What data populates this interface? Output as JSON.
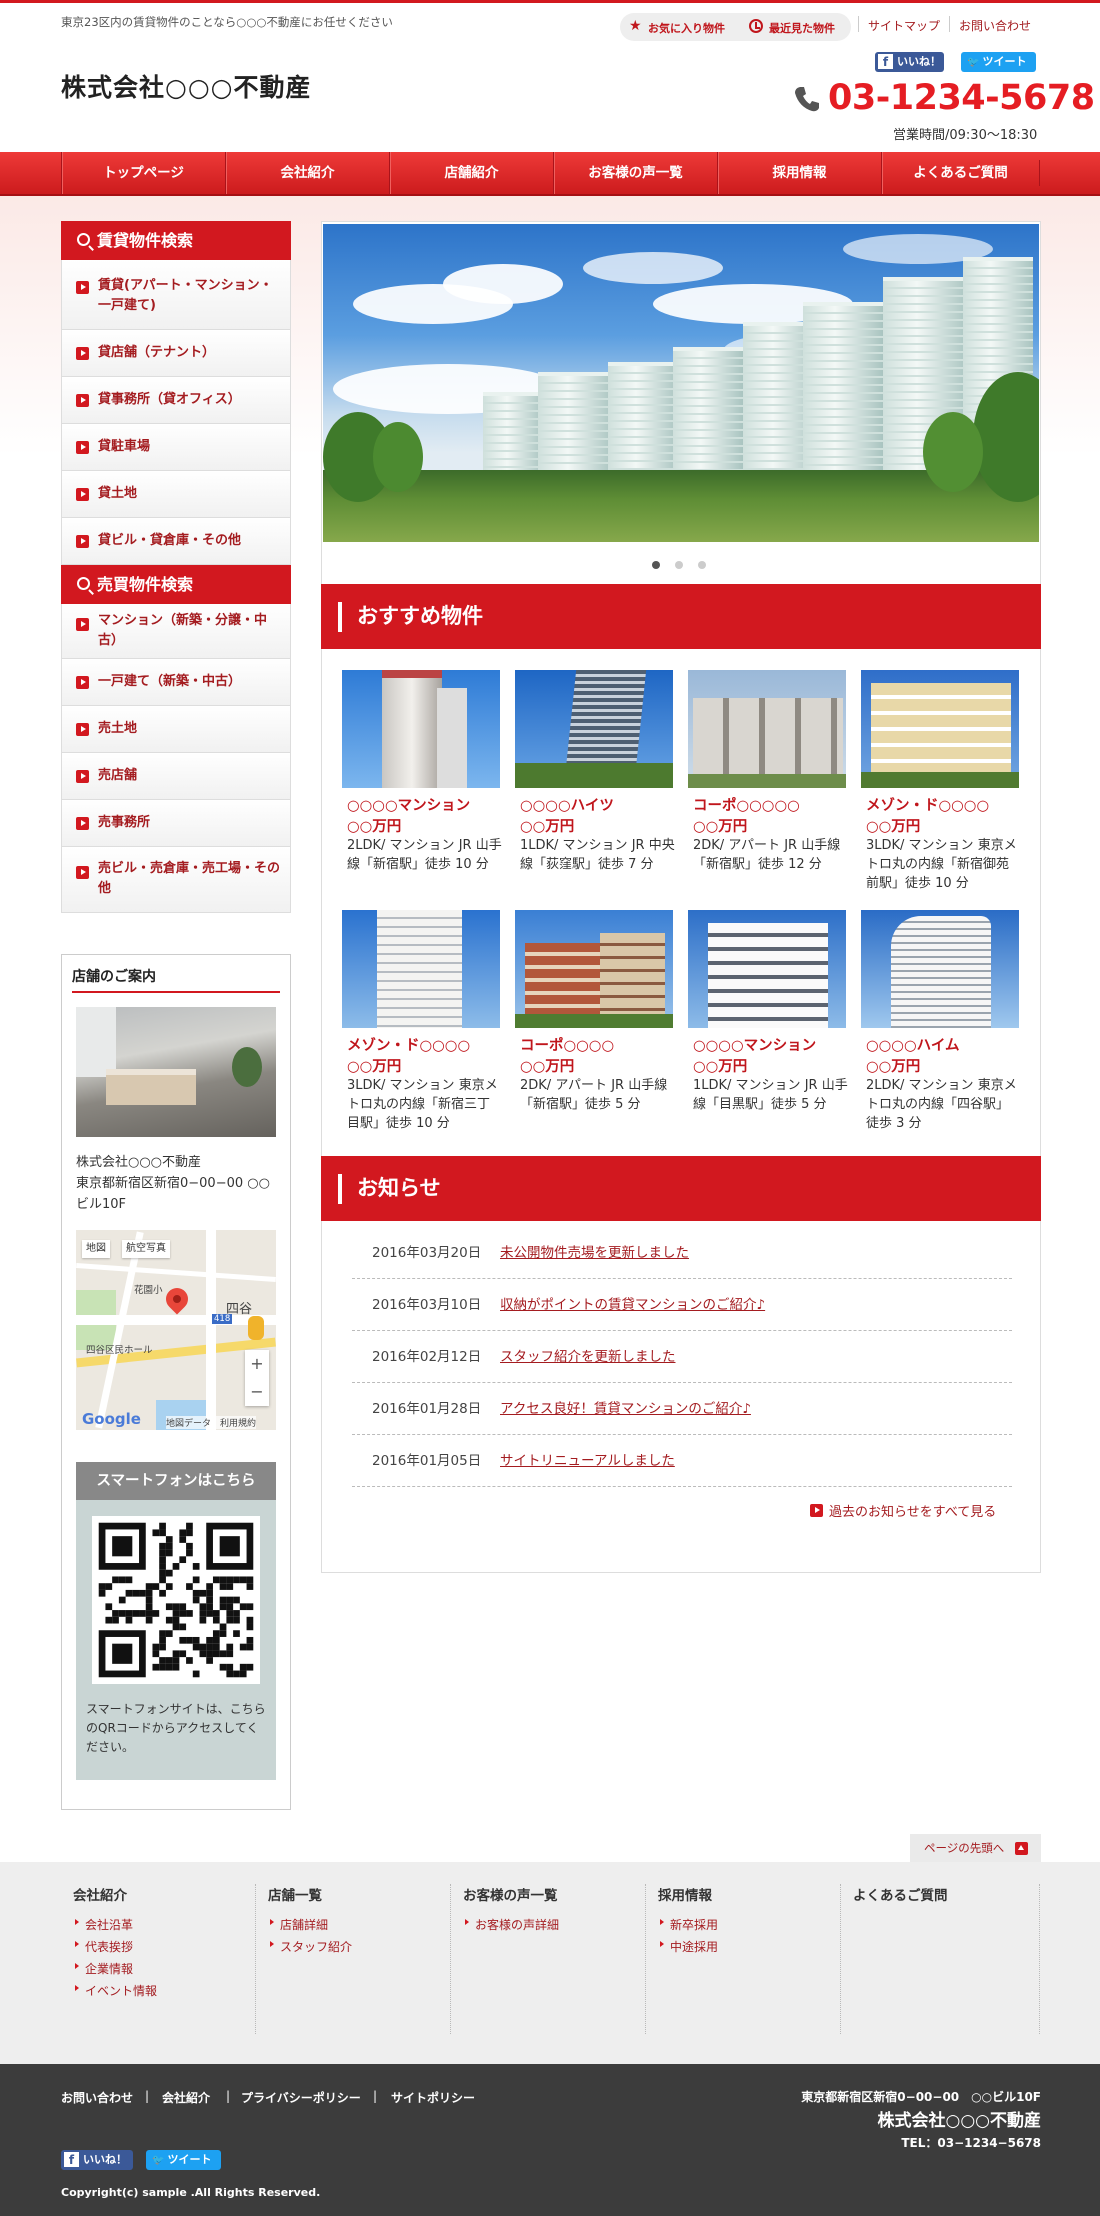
{
  "header": {
    "tagline": "東京23区内の賃貸物件のことなら○○○不動産にお任せください",
    "favorites": "お気に入り物件",
    "recently_viewed": "最近見た物件",
    "sitemap": "サイトマップ",
    "contact": "お問い合わせ",
    "company_name": "株式会社○○○不動産",
    "like": "いいね！",
    "tweet": "ツイート",
    "phone": "03-1234-5678",
    "hours": "営業時間/09:30〜18:30"
  },
  "nav": [
    "トップページ",
    "会社紹介",
    "店舗紹介",
    "お客様の声一覧",
    "採用情報",
    "よくあるご質問"
  ],
  "sidebar": {
    "rental_title": "賃貸物件検索",
    "rental_items": [
      "賃貸(アパート・マンション・一戸建て)",
      "貸店舗（テナント）",
      "貸事務所（貸オフィス）",
      "貸駐車場",
      "貸土地",
      "貸ビル・貸倉庫・その他"
    ],
    "sale_title": "売買物件検索",
    "sale_items": [
      "マンション（新築・分譲・中古）",
      "一戸建て（新築・中古）",
      "売土地",
      "売店舗",
      "売事務所",
      "売ビル・売倉庫・売工場・その他"
    ],
    "shop_title": "店舗のご案内",
    "shop_name": "株式会社○○○不動産",
    "shop_address": "東京都新宿区新宿0−00−00 ○○ビル10F",
    "map": {
      "tab_map": "地図",
      "tab_sat": "航空写真",
      "label_hanazono": "花園小",
      "label_yotsuya": "四谷",
      "label_road": "四谷区民ホール",
      "label_route": "418",
      "credit": "地図データ　利用規約",
      "zoom_in": "+",
      "zoom_out": "−"
    },
    "smartphone_title": "スマートフォンはこちら",
    "smartphone_text": "スマートフォンサイトは、こちらのQRコードからアクセスしてください。"
  },
  "slider": {
    "slide_count": 3,
    "active_index": 0
  },
  "recommend": {
    "title": "おすすめ物件",
    "items": [
      {
        "name": "○○○○マンション",
        "price": "○○万円",
        "detail": "2LDK/ マンション JR 山手線「新宿駅」徒歩 10 分"
      },
      {
        "name": "○○○○ハイツ",
        "price": "○○万円",
        "detail": "1LDK/ マンション JR 中央線「荻窪駅」徒歩 7 分"
      },
      {
        "name": "コーポ○○○○○",
        "price": "○○万円",
        "detail": "2DK/ アパート JR 山手線「新宿駅」徒歩 12 分"
      },
      {
        "name": "メゾン・ド○○○○",
        "price": "○○万円",
        "detail": "3LDK/ マンション 東京メトロ丸の内線「新宿御苑前駅」徒歩 10 分"
      },
      {
        "name": "メゾン・ド○○○○",
        "price": "○○万円",
        "detail": "3LDK/ マンション 東京メトロ丸の内線「新宿三丁目駅」徒歩 10 分"
      },
      {
        "name": "コーポ○○○○",
        "price": "○○万円",
        "detail": "2DK/ アパート JR 山手線「新宿駅」徒歩 5 分"
      },
      {
        "name": "○○○○マンション",
        "price": "○○万円",
        "detail": "1LDK/ マンション JR 山手線「目黒駅」徒歩 5 分"
      },
      {
        "name": "○○○○ハイム",
        "price": "○○万円",
        "detail": "2LDK/ マンション 東京メトロ丸の内線「四谷駅」徒歩 3 分"
      }
    ]
  },
  "news": {
    "title": "お知らせ",
    "items": [
      {
        "date": "2016年03月20日",
        "text": "未公開物件売場を更新しました"
      },
      {
        "date": "2016年03月10日",
        "text": "収納がポイントの賃貸マンションのご紹介♪"
      },
      {
        "date": "2016年02月12日",
        "text": "スタッフ紹介を更新しました"
      },
      {
        "date": "2016年01月28日",
        "text": "アクセス良好！賃貸マンションのご紹介♪"
      },
      {
        "date": "2016年01月05日",
        "text": "サイトリニューアルしました"
      }
    ],
    "more": "過去のお知らせをすべて見る"
  },
  "pagetop": "ページの先頭へ",
  "footer_nav": [
    {
      "title": "会社紹介",
      "links": [
        "会社沿革",
        "代表挨拶",
        "企業情報",
        "イベント情報"
      ]
    },
    {
      "title": "店舗一覧",
      "links": [
        "店舗詳細",
        "スタッフ紹介"
      ]
    },
    {
      "title": "お客様の声一覧",
      "links": [
        "お客様の声詳細"
      ]
    },
    {
      "title": "採用情報",
      "links": [
        "新卒採用",
        "中途採用"
      ]
    },
    {
      "title": "よくあるご質問",
      "links": []
    }
  ],
  "footer": {
    "links": [
      "お問い合わせ",
      "会社紹介",
      "プライバシーポリシー",
      "サイトポリシー"
    ],
    "separator": "|",
    "address": "東京都新宿区新宿0−00−00　○○ビル10F",
    "company": "株式会社○○○不動産",
    "tel": "TEL：03−1234−5678",
    "copyright": "Copyright(c) sample .All Rights Reserved."
  },
  "colors": {
    "primary": "#d2181f",
    "link": "#a41c20",
    "footer_bg": "#3c3c3c",
    "footnav_bg": "#eeeeee"
  }
}
